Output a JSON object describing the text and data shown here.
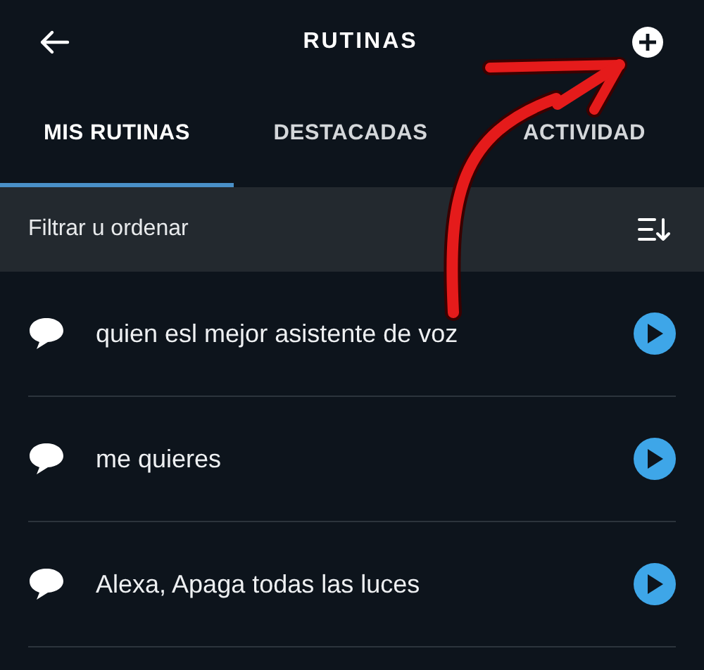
{
  "header": {
    "title": "RUTINAS"
  },
  "tabs": [
    {
      "label": "MIS RUTINAS",
      "selected": true
    },
    {
      "label": "DESTACADAS",
      "selected": false
    },
    {
      "label": "ACTIVIDAD",
      "selected": false
    }
  ],
  "filter_bar": {
    "label": "Filtrar u ordenar"
  },
  "routines": [
    {
      "name": "quien esl mejor asistente de voz"
    },
    {
      "name": "me quieres"
    },
    {
      "name": "Alexa, Apaga todas las luces"
    }
  ]
}
